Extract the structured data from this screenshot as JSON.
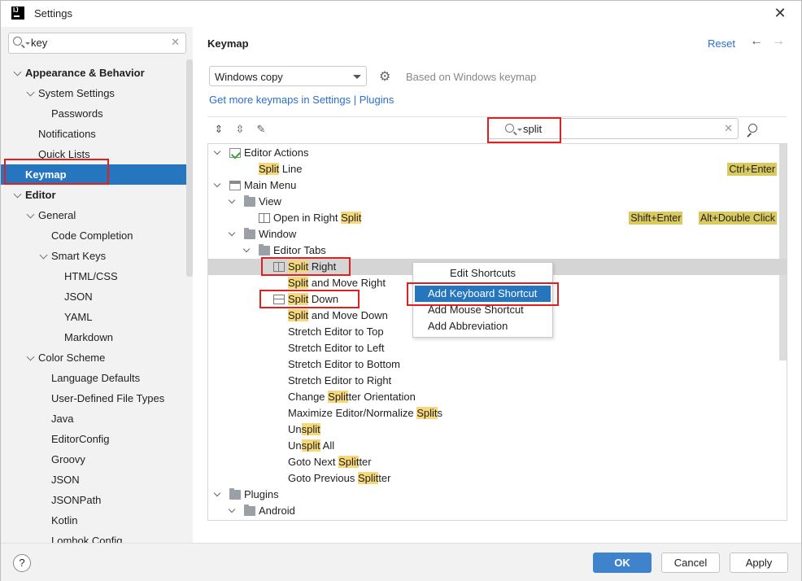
{
  "window": {
    "title": "Settings",
    "close_glyph": "✕",
    "logo_text": "IJ"
  },
  "left_search": {
    "value": "key",
    "clear_glyph": "✕"
  },
  "nav": [
    {
      "label": "Appearance & Behavior",
      "level": 0,
      "expanded": true,
      "bold": true
    },
    {
      "label": "System Settings",
      "level": 1,
      "expanded": true
    },
    {
      "label": "Passwords",
      "level": 2
    },
    {
      "label": "Notifications",
      "level": 1
    },
    {
      "label": "Quick Lists",
      "level": 1
    },
    {
      "label": "Keymap",
      "level": 0,
      "bold": true,
      "selected": true
    },
    {
      "label": "Editor",
      "level": 0,
      "expanded": true,
      "bold": true
    },
    {
      "label": "General",
      "level": 1,
      "expanded": true
    },
    {
      "label": "Code Completion",
      "level": 2
    },
    {
      "label": "Smart Keys",
      "level": 2,
      "expanded": true
    },
    {
      "label": "HTML/CSS",
      "level": 3
    },
    {
      "label": "JSON",
      "level": 3
    },
    {
      "label": "YAML",
      "level": 3
    },
    {
      "label": "Markdown",
      "level": 3
    },
    {
      "label": "Color Scheme",
      "level": 1,
      "expanded": true
    },
    {
      "label": "Language Defaults",
      "level": 2
    },
    {
      "label": "User-Defined File Types",
      "level": 2
    },
    {
      "label": "Java",
      "level": 2
    },
    {
      "label": "EditorConfig",
      "level": 2
    },
    {
      "label": "Groovy",
      "level": 2
    },
    {
      "label": "JSON",
      "level": 2
    },
    {
      "label": "JSONPath",
      "level": 2
    },
    {
      "label": "Kotlin",
      "level": 2
    },
    {
      "label": "Lombok Config",
      "level": 2
    }
  ],
  "keymap": {
    "title": "Keymap",
    "reset": "Reset",
    "back_glyph": "←",
    "forward_glyph": "→",
    "scheme": "Windows copy",
    "based_on": "Based on Windows keymap",
    "get_more": "Get more keymaps in Settings | Plugins",
    "filter": "split",
    "filter_clear_glyph": "✕"
  },
  "tree": [
    {
      "level": 0,
      "expanded": true,
      "icon": "actions",
      "parts": [
        {
          "t": "Editor Actions"
        }
      ]
    },
    {
      "level": 1,
      "parts": [
        {
          "t": "Split",
          "h": true
        },
        {
          "t": " Line"
        }
      ],
      "shortcuts": [
        "Ctrl+Enter"
      ]
    },
    {
      "level": 0,
      "expanded": true,
      "icon": "menu",
      "parts": [
        {
          "t": "Main Menu"
        }
      ]
    },
    {
      "level": 1,
      "expanded": true,
      "icon": "folder",
      "parts": [
        {
          "t": "View"
        }
      ]
    },
    {
      "level": 2,
      "icon": "split-v",
      "parts": [
        {
          "t": "Open in Right "
        },
        {
          "t": "Split",
          "h": true
        }
      ],
      "shortcuts": [
        "Shift+Enter",
        "Alt+Double Click"
      ]
    },
    {
      "level": 1,
      "expanded": true,
      "icon": "folder",
      "parts": [
        {
          "t": "Window"
        }
      ]
    },
    {
      "level": 2,
      "expanded": true,
      "icon": "folder",
      "parts": [
        {
          "t": "Editor Tabs"
        }
      ]
    },
    {
      "level": 3,
      "icon": "split-v",
      "selected": true,
      "parts": [
        {
          "t": "Split",
          "h": true
        },
        {
          "t": " Right"
        }
      ]
    },
    {
      "level": 3,
      "parts": [
        {
          "t": "Split",
          "h": true
        },
        {
          "t": " and Move Right"
        }
      ]
    },
    {
      "level": 3,
      "icon": "split-h",
      "parts": [
        {
          "t": "Split",
          "h": true
        },
        {
          "t": " Down"
        }
      ]
    },
    {
      "level": 3,
      "parts": [
        {
          "t": "Split",
          "h": true
        },
        {
          "t": " and Move Down"
        }
      ]
    },
    {
      "level": 3,
      "parts": [
        {
          "t": "Stretch Editor to Top"
        }
      ]
    },
    {
      "level": 3,
      "parts": [
        {
          "t": "Stretch Editor to Left"
        }
      ]
    },
    {
      "level": 3,
      "parts": [
        {
          "t": "Stretch Editor to Bottom"
        }
      ]
    },
    {
      "level": 3,
      "parts": [
        {
          "t": "Stretch Editor to Right"
        }
      ]
    },
    {
      "level": 3,
      "parts": [
        {
          "t": "Change "
        },
        {
          "t": "Split",
          "h": true
        },
        {
          "t": "ter Orientation"
        }
      ]
    },
    {
      "level": 3,
      "parts": [
        {
          "t": "Maximize Editor/Normalize "
        },
        {
          "t": "Split",
          "h": true
        },
        {
          "t": "s"
        }
      ]
    },
    {
      "level": 3,
      "parts": [
        {
          "t": "Un"
        },
        {
          "t": "split",
          "h": true
        }
      ]
    },
    {
      "level": 3,
      "parts": [
        {
          "t": "Un"
        },
        {
          "t": "split",
          "h": true
        },
        {
          "t": " All"
        }
      ]
    },
    {
      "level": 3,
      "parts": [
        {
          "t": "Goto Next "
        },
        {
          "t": "Split",
          "h": true
        },
        {
          "t": "ter"
        }
      ]
    },
    {
      "level": 3,
      "parts": [
        {
          "t": "Goto Previous "
        },
        {
          "t": "Split",
          "h": true
        },
        {
          "t": "ter"
        }
      ]
    },
    {
      "level": 0,
      "expanded": true,
      "icon": "folder",
      "parts": [
        {
          "t": "Plugins"
        }
      ]
    },
    {
      "level": 1,
      "expanded": true,
      "icon": "folder",
      "parts": [
        {
          "t": "Android"
        }
      ]
    }
  ],
  "context_menu": {
    "header": "Edit Shortcuts",
    "items": [
      {
        "label": "Add Keyboard Shortcut",
        "active": true
      },
      {
        "label": "Add Mouse Shortcut"
      },
      {
        "label": "Add Abbreviation"
      }
    ]
  },
  "buttons": {
    "help": "?",
    "ok": "OK",
    "cancel": "Cancel",
    "apply": "Apply"
  },
  "colors": {
    "selection": "#2675bf",
    "link": "#2b6ecb",
    "highlight": "#f6d87a",
    "shortcut_bg": "#d9c95f",
    "annotation": "#e02020"
  }
}
